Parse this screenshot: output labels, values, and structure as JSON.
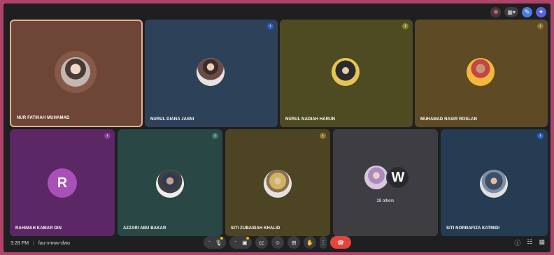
{
  "participants": [
    {
      "name": "NUR FATIHAH MUHAMAD",
      "bg": "#6e4637",
      "active": true
    },
    {
      "name": "NURUL DIANA JASNI",
      "bg": "#2d4159"
    },
    {
      "name": "NURUL NADIAH HARUN",
      "bg": "#4e4b23"
    },
    {
      "name": "MUHAMAD NASIR ROSLAN",
      "bg": "#5e4a24"
    },
    {
      "name": "RAHIMAH KAMAR DIN",
      "bg": "#5b2765",
      "initial": "R",
      "initial_bg": "#a950b8"
    },
    {
      "name": "AZZARI ABU BAKAR",
      "bg": "#284745"
    },
    {
      "name": "SITI ZUBAIDAH KHALID",
      "bg": "#4d4424"
    },
    {
      "others_label": "28 others",
      "bg": "#3d3d42",
      "initial": "W"
    },
    {
      "name": "SITI NORNAFIZA KATMIDI",
      "bg": "#253c52"
    }
  ],
  "footer": {
    "time": "3:28 PM",
    "separator": "|",
    "meeting_code": "fau-vmwv-dwo"
  },
  "icons": {
    "topbar": [
      "record-icon",
      "layout-icon",
      "edit-icon",
      "apps-icon"
    ],
    "controls": [
      "mic-icon",
      "camera-icon",
      "captions-icon",
      "emoji-icon",
      "present-icon",
      "raise-hand-icon",
      "more-icon",
      "end-call-icon"
    ],
    "right": [
      "info-icon",
      "people-icon",
      "activities-icon"
    ]
  },
  "colors": {
    "end_call": "#e5443a",
    "page_border": "#b0436a",
    "frame": "#1f1f22"
  }
}
